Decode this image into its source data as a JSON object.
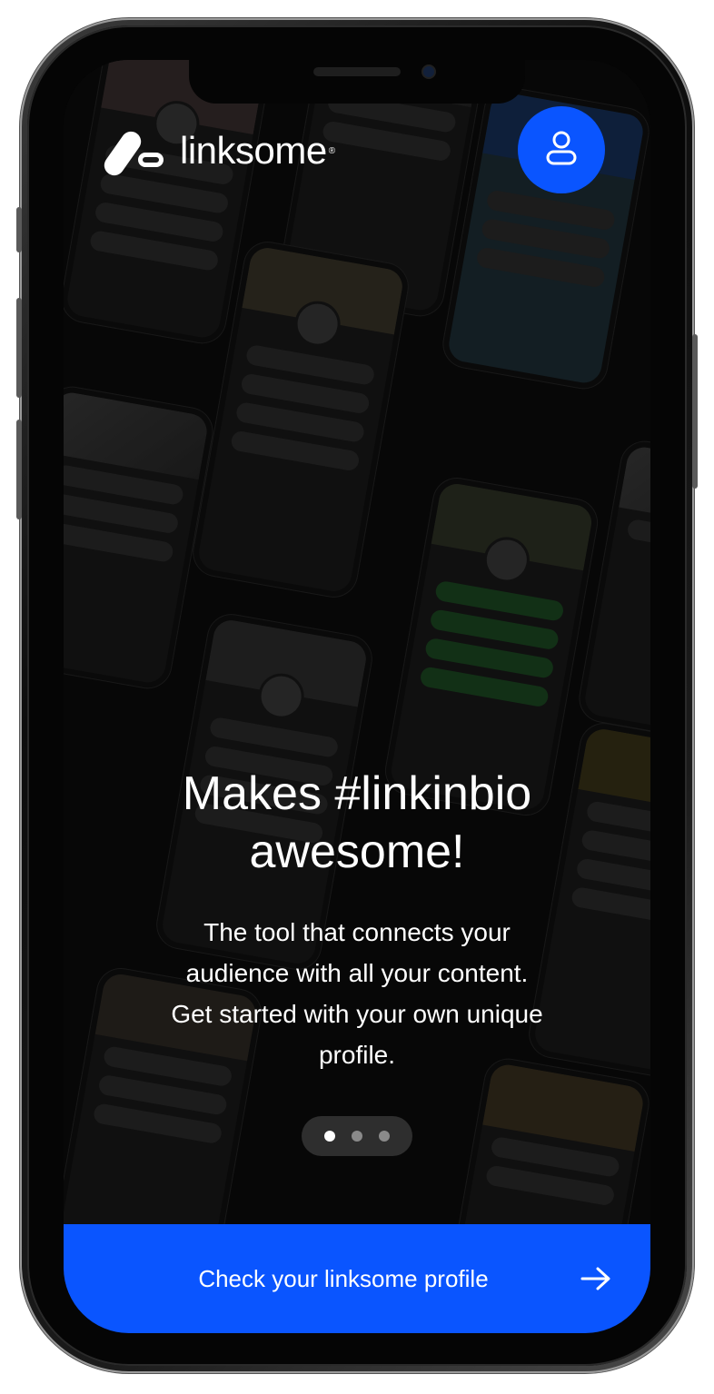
{
  "brand": {
    "name": "linksome",
    "reg_mark": "®"
  },
  "header": {
    "profile_icon": "user-icon"
  },
  "hero": {
    "headline_line1": "Makes #linkinbio",
    "headline_line2": "awesome!",
    "sub_line1": "The tool that connects your",
    "sub_line2": "audience with all your content.",
    "sub_line3": "Get started with your own unique",
    "sub_line4": "profile."
  },
  "carousel": {
    "pages": 3,
    "active_index": 0
  },
  "cta": {
    "label": "Check your linksome profile",
    "icon": "arrow-right-icon"
  },
  "colors": {
    "accent": "#0a55ff",
    "background": "#0b0b0b",
    "text": "#ffffff"
  }
}
